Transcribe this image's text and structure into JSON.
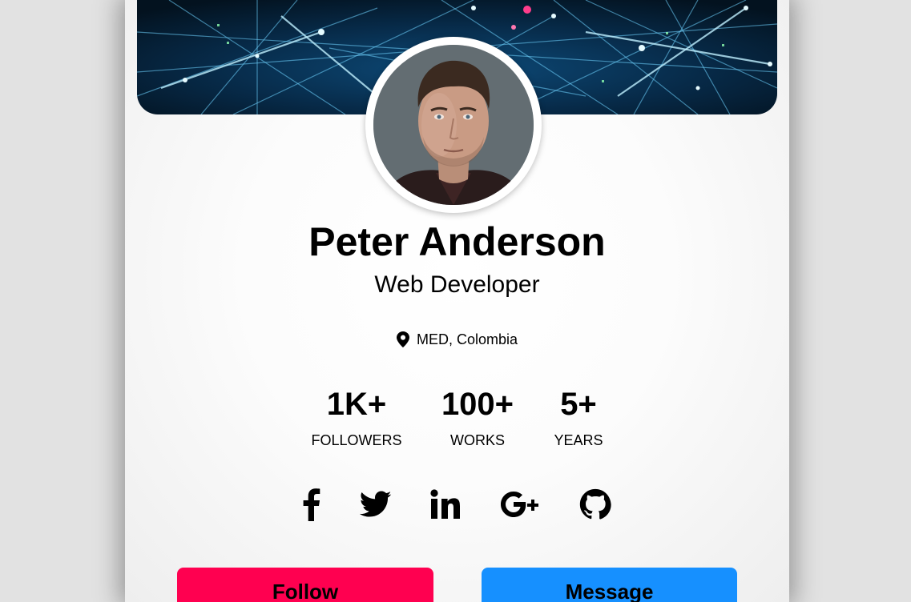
{
  "profile": {
    "name": "Peter Anderson",
    "role": "Web Developer",
    "location": "MED, Colombia"
  },
  "stats": [
    {
      "value": "1K+",
      "label": "FOLLOWERS"
    },
    {
      "value": "100+",
      "label": "WORKS"
    },
    {
      "value": "5+",
      "label": "YEARS"
    }
  ],
  "social": [
    {
      "icon": "facebook-icon"
    },
    {
      "icon": "twitter-icon"
    },
    {
      "icon": "linkedin-icon"
    },
    {
      "icon": "google-plus-icon"
    },
    {
      "icon": "github-icon"
    }
  ],
  "actions": {
    "follow_label": "Follow",
    "message_label": "Message"
  },
  "colors": {
    "follow": "#ff0050",
    "message": "#1690ff",
    "background": "#e2e2e2"
  }
}
